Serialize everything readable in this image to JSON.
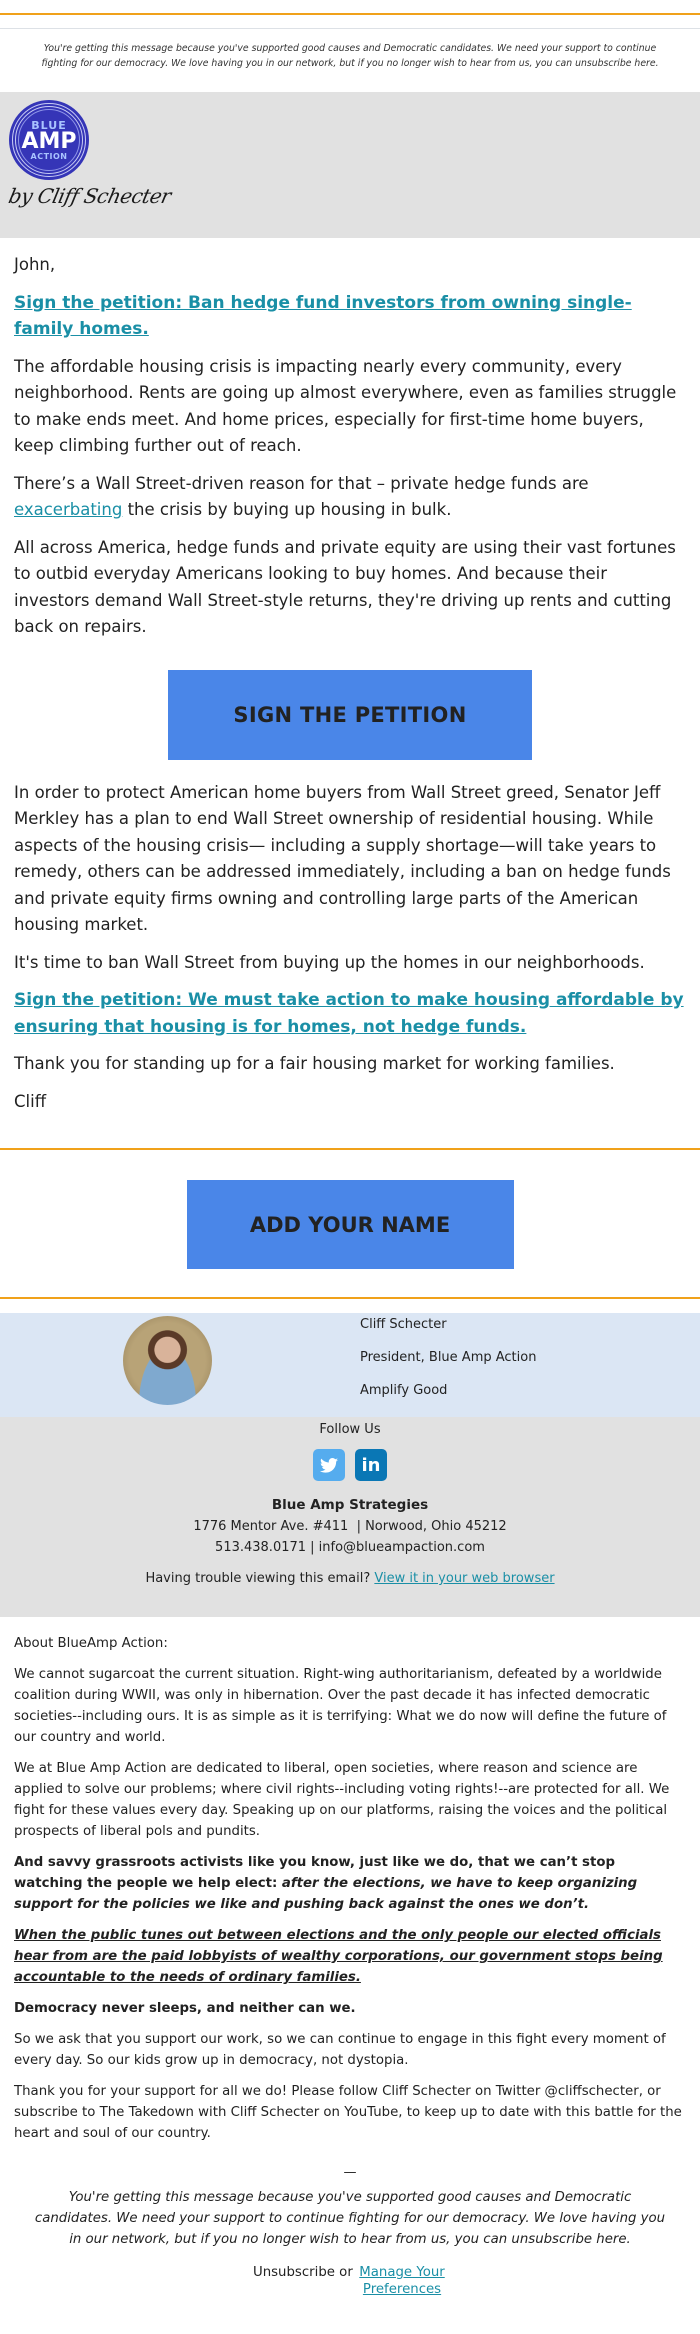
{
  "preheader": {
    "text": "You're getting this message because you've supported good causes and Democratic candidates. We need your support to continue fighting for our democracy. We love having you in our network, but if you no longer wish to hear from us, you can unsubscribe here."
  },
  "header": {
    "logo": {
      "line1": "BLUE",
      "line2": "AMP",
      "line3": "ACTION",
      "signature": "by Cliff Schecter",
      "badge_color": "#3535b7"
    }
  },
  "body": {
    "greeting": "John,",
    "headline_link": "Sign the petition: Ban hedge fund investors from owning single-family homes.",
    "para1": "The affordable housing crisis is impacting nearly every community, every neighborhood. Rents are going up almost everywhere, even as families struggle to make ends meet. And home prices, especially for first-time home buyers, keep climbing further out of reach.",
    "para2_before": "There’s a Wall Street-driven reason for that – private hedge funds are ",
    "para2_link": "exacerbating",
    "para2_after": " the crisis by buying up housing in bulk.",
    "para3": "All across America, hedge funds and private equity are using their vast fortunes to outbid everyday Americans looking to buy homes. And because their investors demand Wall Street-style returns, they're driving up rents and cutting back on repairs.",
    "cta1_label": "SIGN THE PETITION",
    "para4": "In order to protect American home buyers from Wall Street greed, Senator Jeff Merkley has a plan to end Wall Street ownership of residential housing. While aspects of the housing crisis— including a supply shortage—will take years to remedy, others can be addressed immediately, including a ban on hedge funds and private equity firms owning and controlling large parts of the American housing market.",
    "para5": "It's time to ban Wall Street from buying up the homes in our neighborhoods.",
    "second_link": "Sign the petition: We must take action to make housing affordable by ensuring that housing is for homes, not hedge funds.",
    "para6": "Thank you for standing up for a fair housing market for working families.",
    "signoff": "Cliff",
    "cta2_label": "ADD YOUR NAME"
  },
  "signature": {
    "name": "Cliff Schecter",
    "title": "President, Blue Amp Action",
    "tagline": "Amplify Good"
  },
  "footer": {
    "follow_label": "Follow Us",
    "social": [
      {
        "name": "twitter",
        "icon": "twitter-icon",
        "color": "#55acee"
      },
      {
        "name": "linkedin",
        "icon": "linkedin-icon",
        "glyph": "in",
        "color": "#0a77b5"
      }
    ],
    "org_name": "Blue Amp Strategies",
    "address": "1776 Mentor Ave. #411  | Norwood, Ohio 45212",
    "contact": "513.438.0171 | info@blueampaction.com",
    "trouble_text": "Having trouble viewing this email? ",
    "trouble_link": "View it in your web browser"
  },
  "about": {
    "heading": "About BlueAmp Action:",
    "p1": "We cannot sugarcoat the current situation. Right-wing authoritarianism, defeated by a worldwide coalition during WWII, was only in hibernation. Over the past decade it has infected democratic societies--including ours. It is as simple as it is terrifying: What we do now will define the future of our country and world.",
    "p2": "We at Blue Amp Action are dedicated to liberal, open societies, where reason and science are applied to solve our problems; where civil rights--including voting rights!--are protected for all. We fight for these values every day. Speaking up on our platforms, raising the voices and the political prospects of liberal pols and pundits.",
    "p3_bold": "And savvy grassroots activists like you know, just like we do, that we can’t stop watching the people we help elect: ",
    "p3_bold_italic": "after the elections, we have to keep organizing support for the policies we like and pushing back against the ones we don’t.",
    "p4": "When the public tunes out between elections and the only people our elected officials hear from are the paid lobbyists of wealthy corporations, our government stops being accountable to the needs of ordinary families.",
    "p5": "Democracy never sleeps, and neither can we.",
    "p6": "So we ask that you support our work, so we can continue to engage in this fight every moment of every day. So our kids grow up in democracy, not dystopia.",
    "p7": "Thank you for your support for all we do! Please follow Cliff Schecter on Twitter @cliffschecter, or subscribe to The Takedown with Cliff Schecter on YouTube, to keep up to date with this battle for the heart and soul of our country.",
    "dash": "—"
  },
  "bottom": {
    "note": "You're getting this message because you've supported good causes and Democratic candidates. We need your support to continue fighting for our democracy. We love having you in our network, but if you no longer wish to hear from us, you can unsubscribe here.",
    "unsubscribe_label": "Unsubscribe",
    "or": " or ",
    "manage_link": "Manage Your Preferences"
  },
  "colors": {
    "accent_orange": "#f0a11a",
    "button_blue": "#4a86e8",
    "link_teal": "#1a8fa6",
    "signature_band": "#dbe6f4",
    "footer_gray": "#e1e1e1"
  }
}
